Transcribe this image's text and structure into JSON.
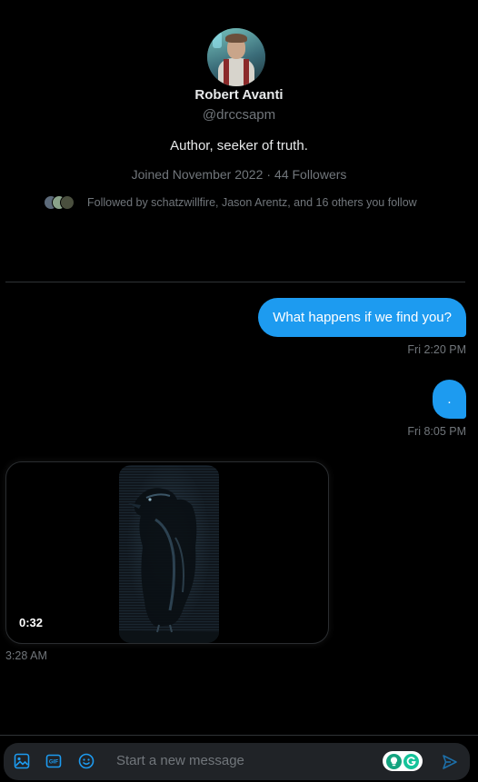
{
  "profile": {
    "name": "Robert Avanti",
    "handle": "@drccsapm",
    "bio": "Author, seeker of truth.",
    "joined": "Joined November 2022",
    "separator": "·",
    "followers": "44 Followers",
    "followed_by": "Followed by schatzwillfire, Jason Arentz, and 16 others you follow"
  },
  "messages": [
    {
      "direction": "outgoing",
      "text": "What happens if we find you?",
      "time": "Fri 2:20 PM"
    },
    {
      "direction": "outgoing",
      "text": ".",
      "time": "Fri 8:05 PM"
    },
    {
      "direction": "incoming",
      "type": "video",
      "duration": "0:32",
      "time": "3:28 AM"
    }
  ],
  "composer": {
    "placeholder": "Start a new message",
    "icons": [
      "image-icon",
      "gif-icon",
      "emoji-icon",
      "grammarly-icon",
      "send-icon"
    ]
  },
  "colors": {
    "background": "#000000",
    "accent": "#1d9bf0",
    "muted_text": "#71767b",
    "divider": "#2f3336",
    "composer_bg": "#202327"
  }
}
